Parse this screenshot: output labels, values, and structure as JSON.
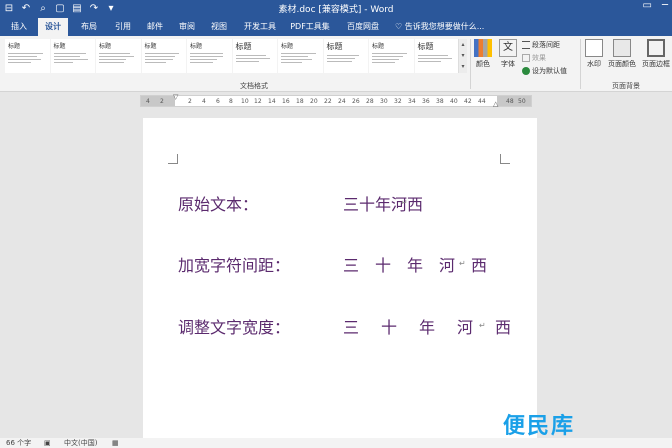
{
  "window": {
    "title": "素材.doc [兼容模式] - Word",
    "controls": [
      "▭",
      "─"
    ]
  },
  "tabs": [
    {
      "label": "插入"
    },
    {
      "label": "设计"
    },
    {
      "label": "布局"
    },
    {
      "label": "引用"
    },
    {
      "label": "邮件"
    },
    {
      "label": "审阅"
    },
    {
      "label": "视图"
    },
    {
      "label": "开发工具"
    },
    {
      "label": "PDF工具集"
    },
    {
      "label": "百度网盘"
    }
  ],
  "tell_me": "告诉我您想要做什么...",
  "ribbon": {
    "styles": [
      "标题",
      "标题",
      "标题",
      "标题",
      "标题",
      "标题",
      "标题",
      "标题",
      "标题",
      "标题"
    ],
    "group_doc_format": "文档格式",
    "color_label": "颜色",
    "font_label": "字体",
    "paragraph_spacing": "段落间距",
    "effects": "效果",
    "set_default": "设为默认值",
    "watermark_label": "水印",
    "page_color": "页面颜色",
    "page_border": "页面边框",
    "group_page_bg": "页面背景"
  },
  "ruler": {
    "ticks": [
      "4",
      "2",
      "",
      "2",
      "4",
      "6",
      "8",
      "10",
      "12",
      "14",
      "16",
      "18",
      "20",
      "22",
      "24",
      "26",
      "28",
      "30",
      "32",
      "34",
      "36",
      "38",
      "40",
      "42",
      "44",
      "",
      "48",
      "50"
    ]
  },
  "document": {
    "line1": {
      "label": "原始文本：",
      "value": "三十年河西"
    },
    "line2": {
      "label": "加宽字符间距：",
      "value": "三十年河西"
    },
    "line3": {
      "label": "调整文字宽度：",
      "chars": [
        "三",
        "十",
        "年",
        "河",
        "西"
      ]
    }
  },
  "status": {
    "words": "66 个字",
    "lang": "中文(中国)"
  },
  "watermark_text": "便民库",
  "colors": {
    "accent": "#2b579a",
    "doc_text": "#5b2a6e",
    "watermark": "#1aa0e8"
  }
}
